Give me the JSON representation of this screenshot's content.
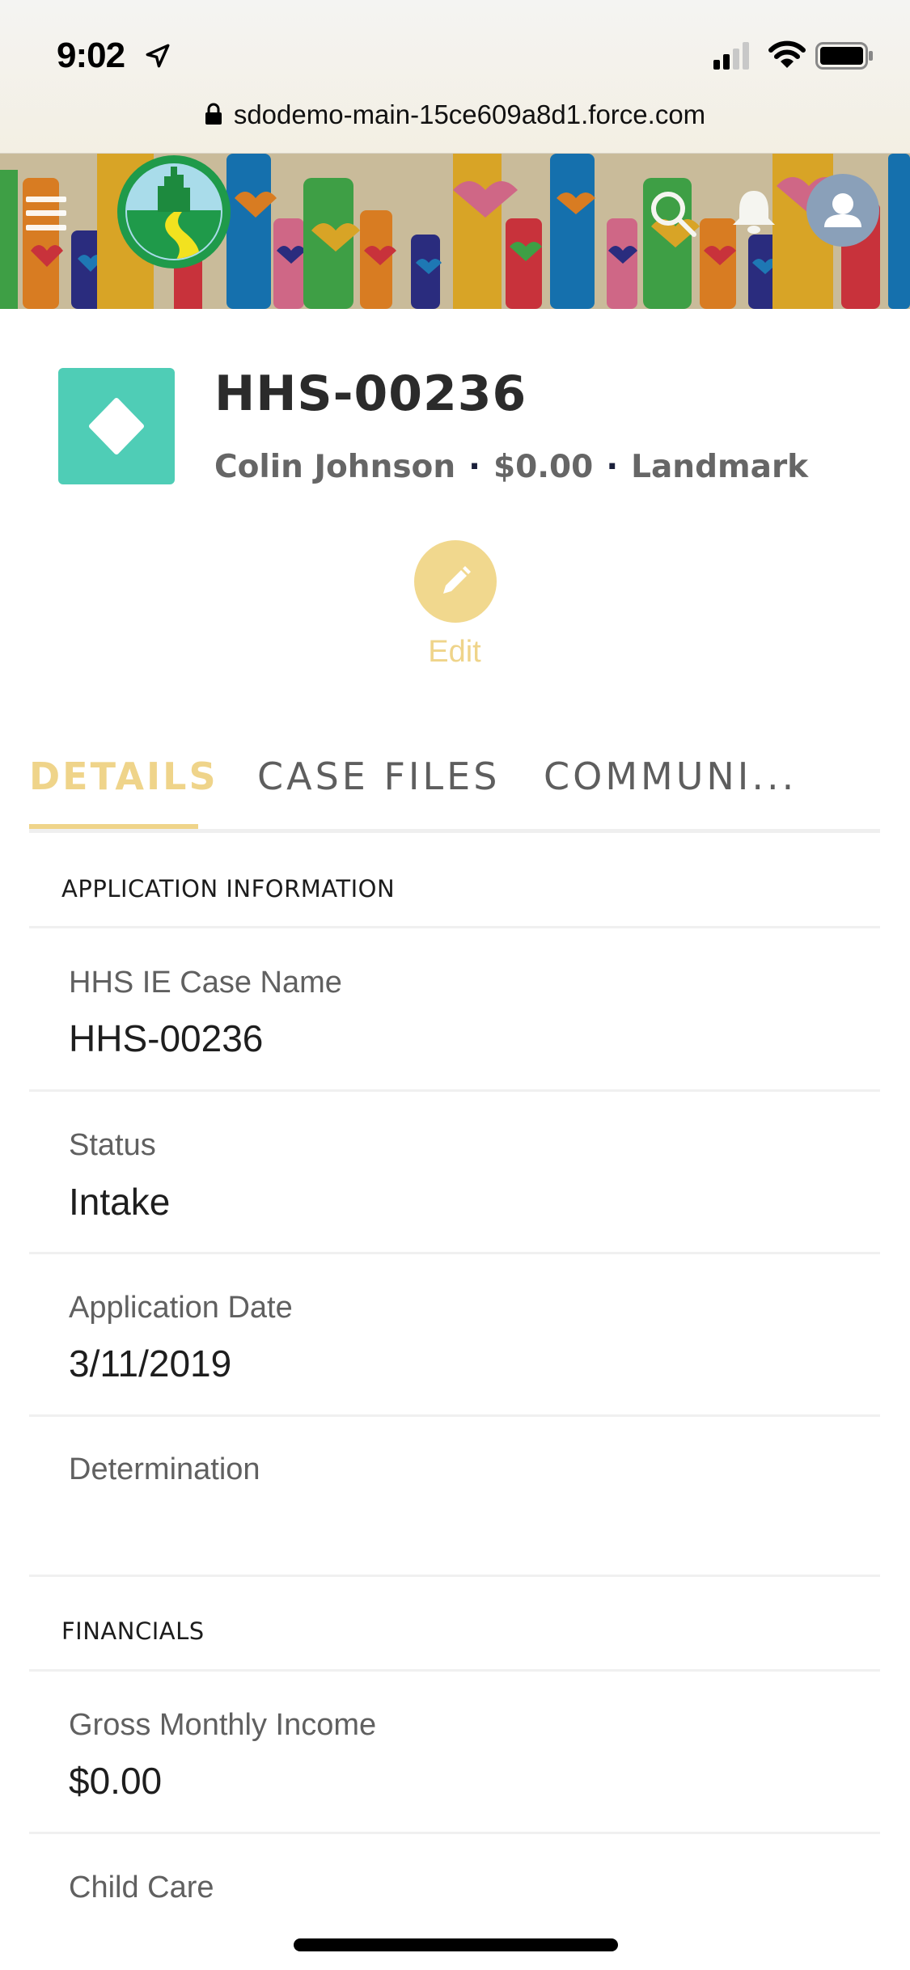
{
  "status_bar": {
    "time": "9:02",
    "icons": [
      "location-arrow-icon",
      "cellular-signal-icon",
      "wifi-icon",
      "battery-icon"
    ]
  },
  "browser": {
    "url": "sdodemo-main-15ce609a8d1.force.com",
    "secure_icon": "lock-icon"
  },
  "header": {
    "menu_icon": "hamburger-menu-icon",
    "logo": "emerald-city-logo",
    "search_icon": "search-icon",
    "notifications_icon": "bell-icon",
    "avatar_icon": "user-avatar-icon"
  },
  "record": {
    "title": "HHS-00236",
    "subtitle_parts": [
      "Colin Johnson",
      "$0.00",
      "Landmark"
    ],
    "separator": "·",
    "icon": "diamond-icon",
    "icon_color": "#4fcdb6"
  },
  "actions": {
    "edit_label": "Edit",
    "accent_color": "#efd48a"
  },
  "tabs": [
    {
      "label": "DETAILS",
      "active": true
    },
    {
      "label": "CASE FILES",
      "active": false
    },
    {
      "label": "COMMUNI...",
      "active": false
    }
  ],
  "sections": [
    {
      "title": "APPLICATION INFORMATION",
      "fields": [
        {
          "label": "HHS IE Case Name",
          "value": "HHS-00236"
        },
        {
          "label": "Status",
          "value": "Intake"
        },
        {
          "label": "Application Date",
          "value": "3/11/2019"
        },
        {
          "label": "Determination",
          "value": ""
        }
      ]
    },
    {
      "title": "FINANCIALS",
      "fields": [
        {
          "label": "Gross Monthly Income",
          "value": "$0.00"
        },
        {
          "label": "Child Care",
          "value": ""
        }
      ]
    }
  ]
}
